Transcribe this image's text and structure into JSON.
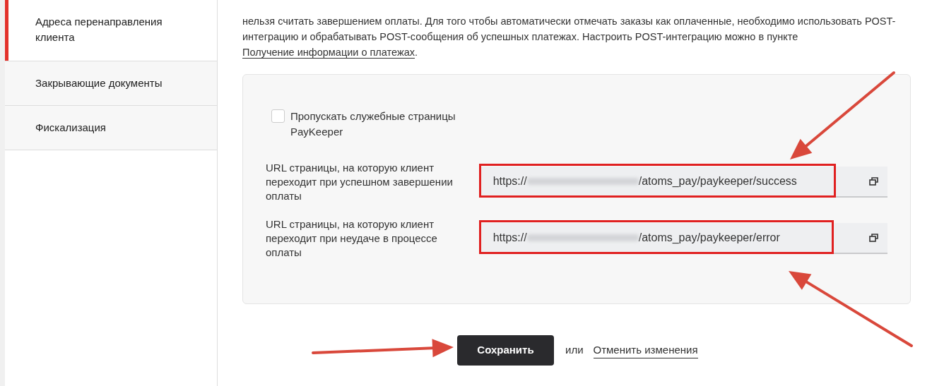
{
  "sidebar": {
    "items": [
      {
        "label": "Адреса перенаправления клиента",
        "selected": true
      },
      {
        "label": "Закрывающие документы",
        "selected": false
      },
      {
        "label": "Фискализация",
        "selected": false
      }
    ]
  },
  "notice": {
    "text": "нельзя считать завершением оплаты. Для того чтобы автоматически отмечать заказы как оплаченные, необходимо использовать POST-интеграцию и обрабатывать POST-сообщения об успешных платежах. Настроить POST-интеграцию можно в пункте ",
    "link": "Получение информации о платежах",
    "end": "."
  },
  "settings": {
    "checkbox": {
      "label": "Пропускать служебные страницы PayKeeper",
      "checked": false
    },
    "fields": [
      {
        "label": "URL страницы, на которую клиент переходит при успешном завершении оплаты",
        "value_prefix": "https://",
        "value_suffix": "/atoms_pay/paykeeper/success",
        "highlighted": true
      },
      {
        "label": "URL страницы, на которую клиент переходит при неудаче в процессе оплаты",
        "value_prefix": "https://",
        "value_suffix": "/atoms_pay/paykeeper/error",
        "highlighted": true
      }
    ]
  },
  "actions": {
    "save": "Сохранить",
    "or": "или",
    "cancel": "Отменить изменения"
  }
}
